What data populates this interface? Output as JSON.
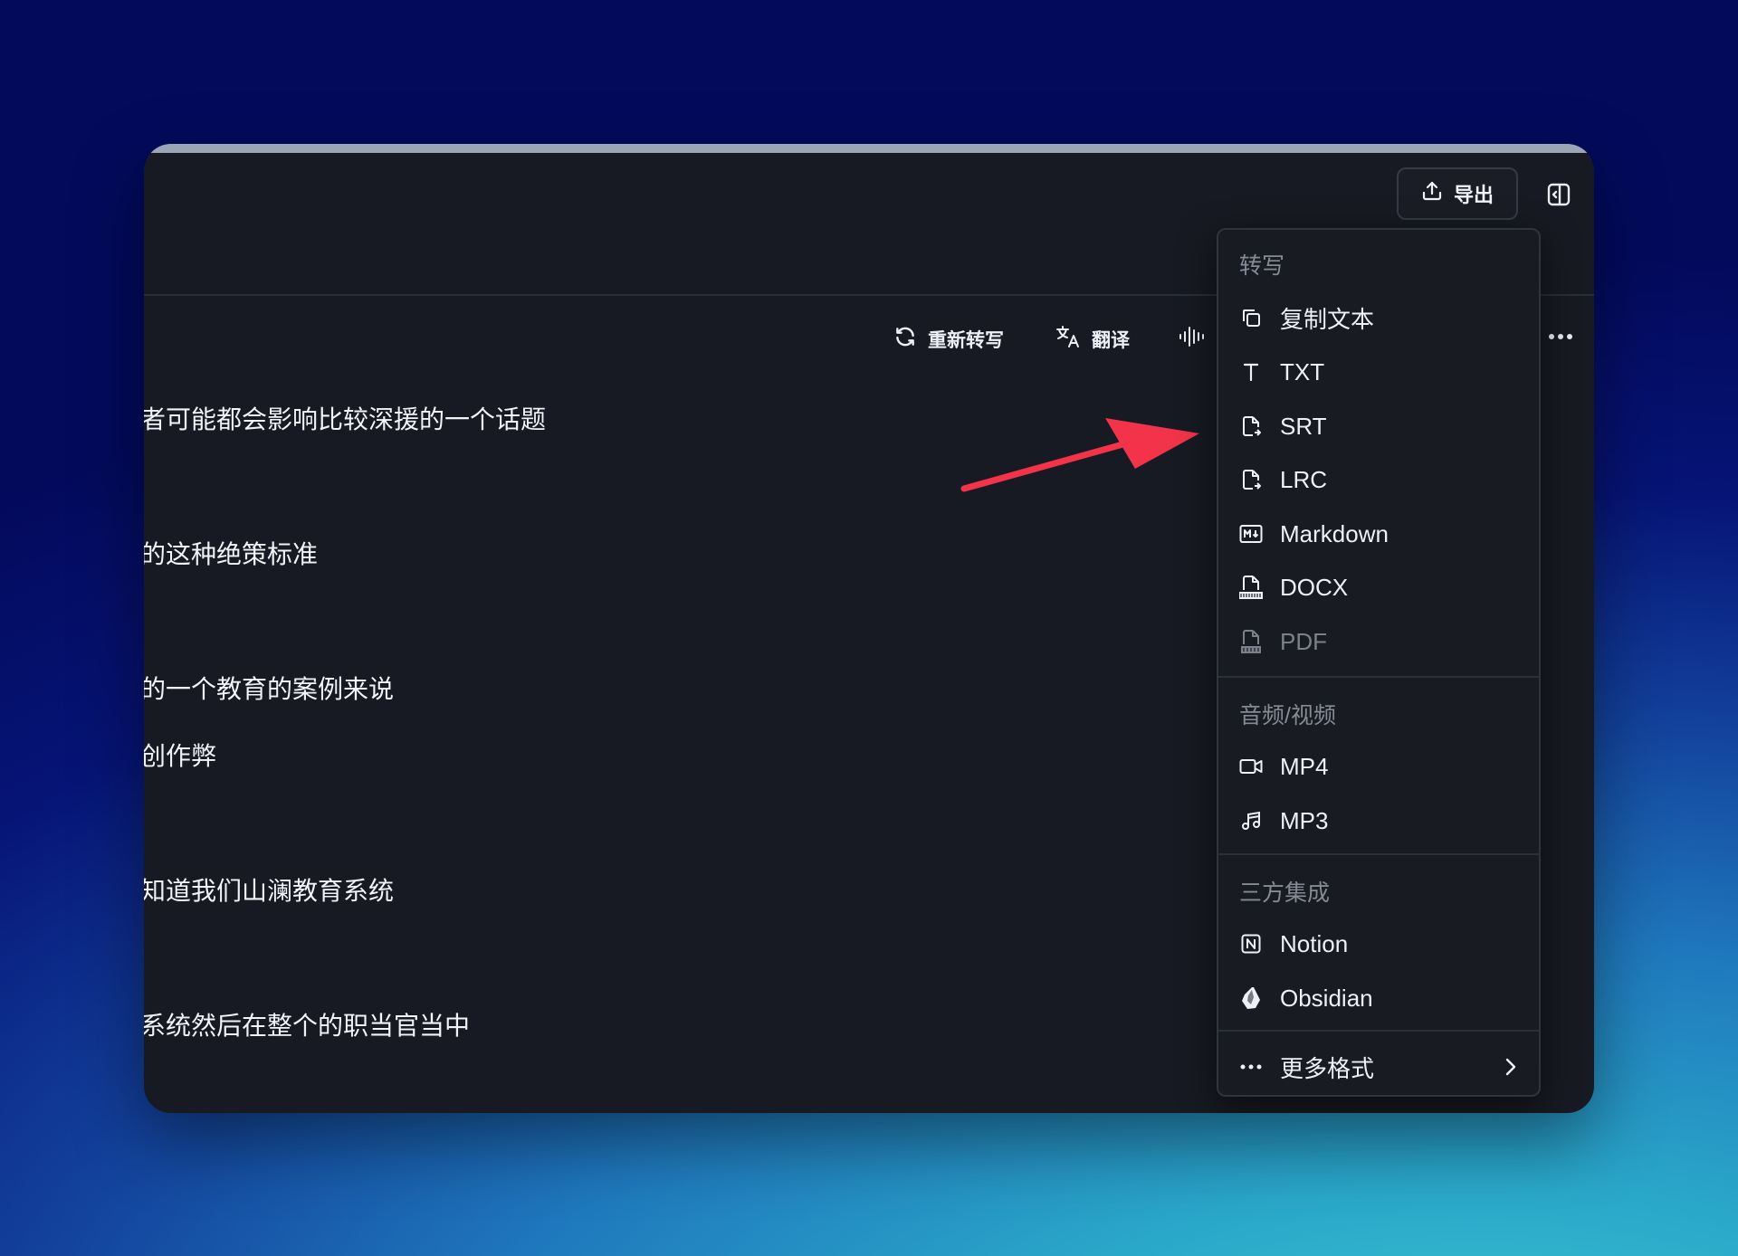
{
  "header": {
    "export_label": "导出"
  },
  "toolbar": {
    "retranscribe_label": "重新转写",
    "translate_label": "翻译"
  },
  "transcript": {
    "lines": [
      "者可能都会影响比较深援的一个话题",
      "的这种绝策标准",
      "的一个教育的案例来说",
      "创作弊",
      "知道我们山澜教育系统",
      "系统然后在整个的职当官当中"
    ]
  },
  "export_menu": {
    "transcript_section": "转写",
    "items_transcript": [
      {
        "label": "复制文本",
        "icon": "copy-icon"
      },
      {
        "label": "TXT",
        "icon": "text-icon"
      },
      {
        "label": "SRT",
        "icon": "subtitle-file-icon"
      },
      {
        "label": "LRC",
        "icon": "lyrics-file-icon"
      },
      {
        "label": "Markdown",
        "icon": "markdown-icon"
      },
      {
        "label": "DOCX",
        "icon": "docx-file-icon"
      },
      {
        "label": "PDF",
        "icon": "pdf-file-icon",
        "disabled": true
      }
    ],
    "media_section": "音频/视频",
    "items_media": [
      {
        "label": "MP4",
        "icon": "video-icon"
      },
      {
        "label": "MP3",
        "icon": "music-icon"
      }
    ],
    "integration_section": "三方集成",
    "items_integration": [
      {
        "label": "Notion",
        "icon": "notion-icon"
      },
      {
        "label": "Obsidian",
        "icon": "obsidian-icon"
      }
    ],
    "more_formats_label": "更多格式"
  },
  "colors": {
    "window_bg": "#171a22",
    "menu_bg": "#181b22",
    "annotation_arrow": "#f2334a"
  }
}
